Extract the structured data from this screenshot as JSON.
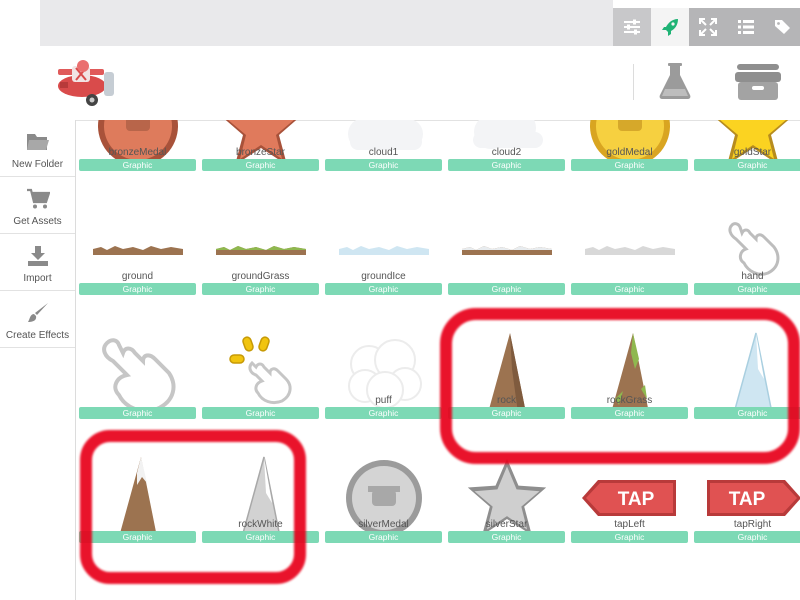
{
  "sidebar": {
    "items": [
      {
        "label": "New Folder",
        "icon": "folder-icon"
      },
      {
        "label": "Get Assets",
        "icon": "cart-icon"
      },
      {
        "label": "Import",
        "icon": "import-icon"
      },
      {
        "label": "Create Effects",
        "icon": "brush-icon"
      }
    ]
  },
  "colors": {
    "badge": "#7dd9b5",
    "annotation": "#e8001a",
    "accent": "#1fb375"
  },
  "assets": {
    "row1": [
      {
        "name": "bronzeMedal",
        "type": "Graphic"
      },
      {
        "name": "bronzeStar",
        "type": "Graphic"
      },
      {
        "name": "cloud1",
        "type": "Graphic"
      },
      {
        "name": "cloud2",
        "type": "Graphic"
      },
      {
        "name": "goldMedal",
        "type": "Graphic"
      },
      {
        "name": "goldStar",
        "type": "Graphic"
      }
    ],
    "row2": [
      {
        "name": "ground",
        "type": "Graphic"
      },
      {
        "name": "groundGrass",
        "type": "Graphic"
      },
      {
        "name": "groundIce",
        "type": "Graphic"
      },
      {
        "name": "",
        "type": "Graphic"
      },
      {
        "name": "",
        "type": "Graphic"
      },
      {
        "name": "hand",
        "type": "Graphic"
      }
    ],
    "row3": [
      {
        "name": "",
        "type": "Graphic"
      },
      {
        "name": "",
        "type": "Graphic"
      },
      {
        "name": "puff",
        "type": "Graphic"
      },
      {
        "name": "rock",
        "type": "Graphic"
      },
      {
        "name": "rockGrass",
        "type": "Graphic"
      },
      {
        "name": "",
        "type": "Graphic"
      }
    ],
    "row4": [
      {
        "name": "",
        "type": "Graphic"
      },
      {
        "name": "rockWhite",
        "type": "Graphic"
      },
      {
        "name": "silverMedal",
        "type": "Graphic"
      },
      {
        "name": "silverStar",
        "type": "Graphic"
      },
      {
        "name": "tapLeft",
        "type": "Graphic"
      },
      {
        "name": "tapRight",
        "type": "Graphic"
      }
    ]
  },
  "tap_label": "TAP",
  "toolbar_icons": [
    "sliders-icon",
    "rocket-icon",
    "fullscreen-icon",
    "list-icon",
    "tags-icon"
  ],
  "header_icons": [
    "plane-logo-icon",
    "flask-icon",
    "asset-box-icon"
  ]
}
